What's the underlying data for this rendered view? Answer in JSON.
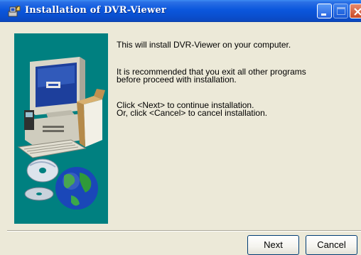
{
  "window": {
    "title": "Installation of DVR-Viewer"
  },
  "content": {
    "intro": "This will install DVR-Viewer on your computer.",
    "recommend_line1": "It is recommended that you exit all other programs",
    "recommend_line2": "before proceed with installation.",
    "next_line": "Click <Next> to continue installation.",
    "cancel_line": "Or, click <Cancel> to cancel installation."
  },
  "buttons": {
    "next_label": "Next",
    "cancel_label": "Cancel"
  },
  "icons": {
    "title_icon": "installer-icon",
    "side_image": "computer-cd-globe-illustration"
  },
  "colors": {
    "titlebar": "#0b57dd",
    "window_bg": "#ece9d8",
    "side_panel": "#008080"
  }
}
